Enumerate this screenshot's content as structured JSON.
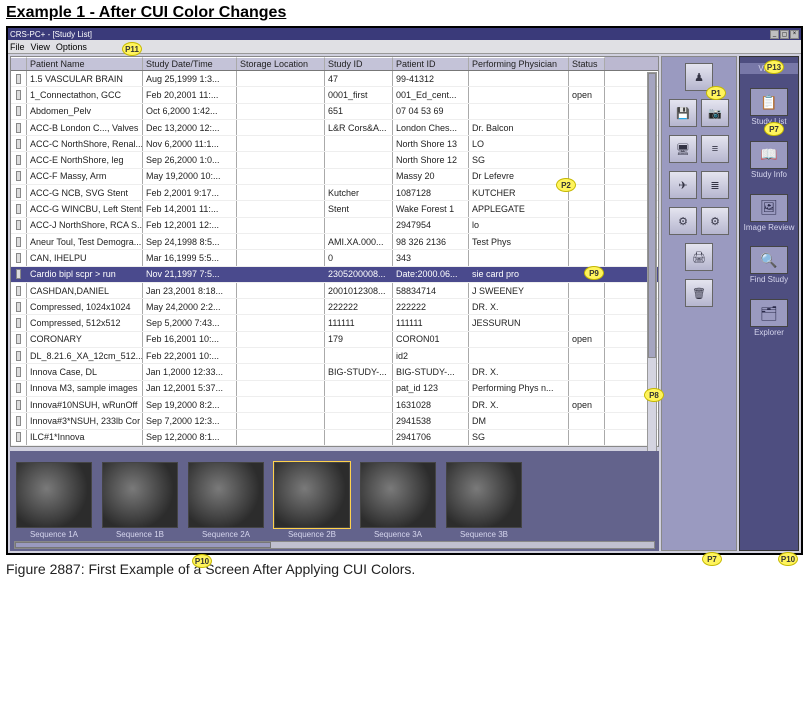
{
  "page_heading": "Example 1 - After CUI Color Changes",
  "caption": "Figure 2887: First Example of a Screen After Applying CUI Colors.",
  "markers": {
    "p1": "P1",
    "p2": "P2",
    "p7a": "P7",
    "p7b": "P7",
    "p8": "P8",
    "p9": "P9",
    "p10a": "P10",
    "p10b": "P10",
    "p11": "P11",
    "p13": "P13"
  },
  "window": {
    "title": "CRS-PC+ - [Study List]",
    "menus": [
      "File",
      "View",
      "Options"
    ],
    "columns": [
      "Patient Name",
      "Study Date/Time",
      "Storage Location",
      "Study ID",
      "Patient ID",
      "Performing Physician",
      "Status"
    ],
    "rows": [
      {
        "name": "1.5 VASCULAR BRAIN",
        "dt": "Aug 25,1999 1:3...",
        "loc": "",
        "sid": "47",
        "pid": "99-41312",
        "phys": "",
        "status": ""
      },
      {
        "name": "1_Connectathon, GCC",
        "dt": "Feb 20,2001 11:...",
        "loc": "",
        "sid": "0001_first",
        "pid": "001_Ed_cent...",
        "phys": "",
        "status": "open"
      },
      {
        "name": "Abdomen_Pelv",
        "dt": "Oct 6,2000 1:42...",
        "loc": "",
        "sid": "651",
        "pid": "07 04 53 69",
        "phys": "",
        "status": ""
      },
      {
        "name": "ACC-B London C..., Valves",
        "dt": "Dec 13,2000 12:...",
        "loc": "",
        "sid": "L&R Cors&A...",
        "pid": "London Ches...",
        "phys": "Dr. Balcon",
        "status": ""
      },
      {
        "name": "ACC-C NorthShore, Renal...",
        "dt": "Nov 6,2000 11:1...",
        "loc": "",
        "sid": "",
        "pid": "North Shore 13",
        "phys": "LO",
        "status": ""
      },
      {
        "name": "ACC-E NorthShore, leg",
        "dt": "Sep 26,2000 1:0...",
        "loc": "",
        "sid": "",
        "pid": "North Shore 12",
        "phys": "SG",
        "status": ""
      },
      {
        "name": "ACC-F Massy, Arm",
        "dt": "May 19,2000 10:...",
        "loc": "",
        "sid": "",
        "pid": "Massy 20",
        "phys": "Dr Lefevre",
        "status": ""
      },
      {
        "name": "ACC-G NCB, SVG Stent",
        "dt": "Feb 2,2001 9:17...",
        "loc": "",
        "sid": "Kutcher",
        "pid": "1087128",
        "phys": "KUTCHER",
        "status": ""
      },
      {
        "name": "ACC-G WINCBU, Left Stent",
        "dt": "Feb 14,2001 11:...",
        "loc": "",
        "sid": "Stent",
        "pid": "Wake Forest 1",
        "phys": "APPLEGATE",
        "status": ""
      },
      {
        "name": "ACC-J NorthShore, RCA S...",
        "dt": "Feb 12,2001 12:...",
        "loc": "",
        "sid": "",
        "pid": "2947954",
        "phys": "lo",
        "status": ""
      },
      {
        "name": "Aneur Toul, Test Demogra...",
        "dt": "Sep 24,1998 8:5...",
        "loc": "",
        "sid": "AMI.XA.000...",
        "pid": "98 326 2136",
        "phys": "Test Phys",
        "status": ""
      },
      {
        "name": "CAN, IHELPU",
        "dt": "Mar 16,1999 5:5...",
        "loc": "",
        "sid": "0",
        "pid": "343",
        "phys": "",
        "status": ""
      },
      {
        "name": "Cardio bipl scpr > run",
        "dt": "Nov 21,1997 7:5...",
        "loc": "",
        "sid": "2305200008...",
        "pid": "Date:2000.06...",
        "phys": "sie card pro",
        "status": "",
        "selected": true
      },
      {
        "name": "CASHDAN,DANIEL",
        "dt": "Jan 23,2001 8:18...",
        "loc": "",
        "sid": "2001012308...",
        "pid": "58834714",
        "phys": "J SWEENEY",
        "status": ""
      },
      {
        "name": "Compressed, 1024x1024",
        "dt": "May 24,2000 2:2...",
        "loc": "",
        "sid": "222222",
        "pid": "222222",
        "phys": "DR. X.",
        "status": ""
      },
      {
        "name": "Compressed, 512x512",
        "dt": "Sep 5,2000 7:43...",
        "loc": "",
        "sid": "111111",
        "pid": "111111",
        "phys": "JESSURUN",
        "status": ""
      },
      {
        "name": "CORONARY",
        "dt": "Feb 16,2001 10:...",
        "loc": "",
        "sid": "179",
        "pid": "CORON01",
        "phys": "",
        "status": "open"
      },
      {
        "name": "DL_8.21.6_XA_12cm_512...",
        "dt": "Feb 22,2001 10:...",
        "loc": "",
        "sid": "",
        "pid": "id2",
        "phys": "",
        "status": ""
      },
      {
        "name": "Innova Case, DL",
        "dt": "Jan 1,2000 12:33...",
        "loc": "",
        "sid": "BIG-STUDY-...",
        "pid": "BIG-STUDY-...",
        "phys": "DR. X.",
        "status": ""
      },
      {
        "name": "Innova M3, sample images",
        "dt": "Jan 12,2001 5:37...",
        "loc": "",
        "sid": "",
        "pid": "pat_id 123",
        "phys": "Performing Phys n...",
        "status": ""
      },
      {
        "name": "Innova#10NSUH, wRunOff",
        "dt": "Sep 19,2000 8:2...",
        "loc": "",
        "sid": "",
        "pid": "1631028",
        "phys": "DR. X.",
        "status": "open"
      },
      {
        "name": "Innova#3*NSUH, 233lb Cor",
        "dt": "Sep 7,2000 12:3...",
        "loc": "",
        "sid": "",
        "pid": "2941538",
        "phys": "DM",
        "status": ""
      },
      {
        "name": "ILC#1*Innova",
        "dt": "Sep 12,2000 8:1...",
        "loc": "",
        "sid": "",
        "pid": "2941706",
        "phys": "SG",
        "status": ""
      }
    ],
    "thumbs": [
      {
        "label": "Sequence 1A"
      },
      {
        "label": "Sequence 1B"
      },
      {
        "label": "Sequence 2A"
      },
      {
        "label": "Sequence 2B",
        "selected": true
      },
      {
        "label": "Sequence 3A"
      },
      {
        "label": "Sequence 3B"
      }
    ],
    "views_header": "Views",
    "views": [
      {
        "label": "Study List",
        "icon": "📋"
      },
      {
        "label": "Study Info",
        "icon": "📖"
      },
      {
        "label": "Image Review",
        "icon": "🖼"
      },
      {
        "label": "Find Study",
        "icon": "🔍"
      },
      {
        "label": "Explorer",
        "icon": "🗂"
      }
    ]
  }
}
